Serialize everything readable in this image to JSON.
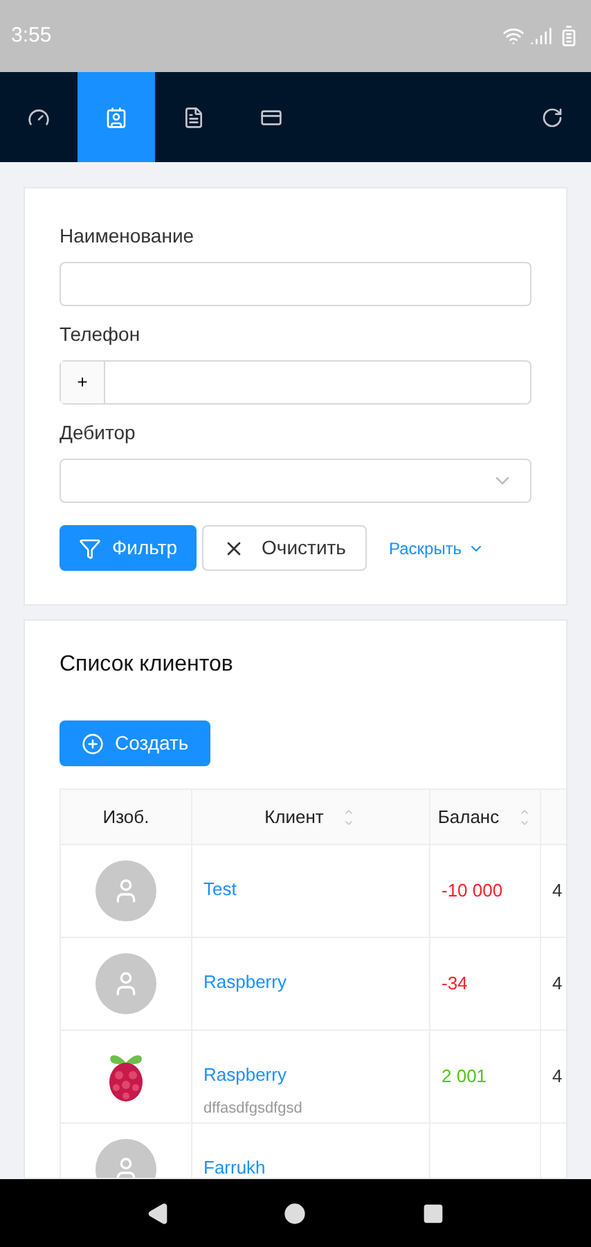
{
  "status_bar": {
    "time": "3:55"
  },
  "nav_tabs": [
    {
      "selected": false
    },
    {
      "selected": true
    },
    {
      "selected": false
    },
    {
      "selected": false
    }
  ],
  "filter": {
    "fields": [
      {
        "kind": "text",
        "label": "Наименование"
      },
      {
        "kind": "phone",
        "label": "Телефон",
        "prefix": "+"
      },
      {
        "kind": "select",
        "label": "Дебитор"
      }
    ],
    "filter_button": "Фильтр",
    "clear_button": "Очистить",
    "expand_link": "Раскрыть"
  },
  "clients": {
    "title": "Список клиентов",
    "create_button": "Создать",
    "columns": [
      {
        "label": "Изоб.",
        "sortable": false
      },
      {
        "label": "Клиент",
        "sortable": true
      },
      {
        "label": "Баланс",
        "sortable": true
      }
    ],
    "rows": [
      {
        "kind": "avatar",
        "name": "Test",
        "balance": "-10 000",
        "column_4": "4"
      },
      {
        "kind": "avatar",
        "name": "Raspberry",
        "balance": "-34",
        "column_4": "4"
      },
      {
        "kind": "logo",
        "name": "Raspberry",
        "note": "dffasdfgsdfgsd",
        "balance": "2 001",
        "column_4": "4"
      },
      {
        "kind": "avatar",
        "name": "Farrukh"
      }
    ]
  }
}
